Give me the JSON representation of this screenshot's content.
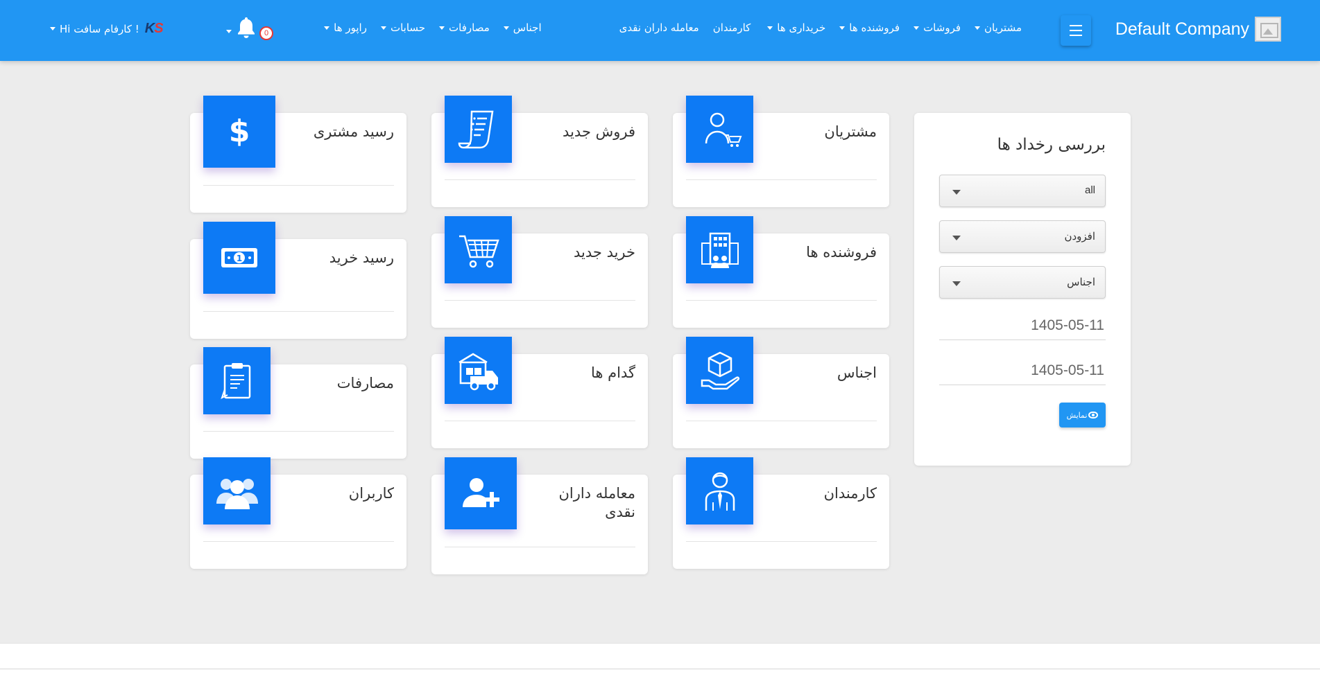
{
  "brand": {
    "name": "Default Company"
  },
  "nav": {
    "items": [
      {
        "label": "مشتریان",
        "dropdown": true
      },
      {
        "label": "فروشات",
        "dropdown": true
      },
      {
        "label": "فروشنده ها",
        "dropdown": true
      },
      {
        "label": "خریداری ها",
        "dropdown": true
      },
      {
        "label": "کارمندان",
        "dropdown": false
      },
      {
        "label": "معامله داران نقدی",
        "dropdown": false
      },
      {
        "label": "اجناس",
        "dropdown": true
      },
      {
        "label": "مصارفات",
        "dropdown": true
      },
      {
        "label": "حسابات",
        "dropdown": true
      },
      {
        "label": "راپور ها",
        "dropdown": true
      }
    ],
    "notifications_count": "0",
    "user_greeting": "Hi کارفام سافت !"
  },
  "panel": {
    "title": "بررسی رخداد ها",
    "select_all": "all",
    "select_action": "افزودن",
    "select_entity": "اجناس",
    "date_from": "1405-05-11",
    "date_to": "1405-05-11",
    "show_button": "نمایش"
  },
  "tiles": {
    "customers": "مشتریان",
    "new_sale": "فروش جدید",
    "customer_receipt": "رسید مشتری",
    "vendors": "فروشنده ها",
    "new_purchase": "خرید جدید",
    "purchase_receipt": "رسید خرید",
    "items": "اجناس",
    "warehouses": "گدام ها",
    "expenses": "مصارفات",
    "employees": "کارمندان",
    "cash_traders": "معامله داران نقدی",
    "users": "کاربران"
  },
  "colors": {
    "navbar": "#2196f3",
    "tile_icon": "#0d7af5",
    "background": "#ececec",
    "badge": "#e53935"
  },
  "icons": {
    "customers": "customer-cart-icon",
    "new_sale": "invoice-icon",
    "customer_receipt": "dollar-icon",
    "vendors": "building-people-icon",
    "new_purchase": "shopping-cart-icon",
    "purchase_receipt": "banknote-icon",
    "items": "box-hand-icon",
    "warehouses": "warehouse-truck-icon",
    "expenses": "clipboard-icon",
    "employees": "employee-icon",
    "cash_traders": "add-user-icon",
    "users": "users-group-icon"
  }
}
